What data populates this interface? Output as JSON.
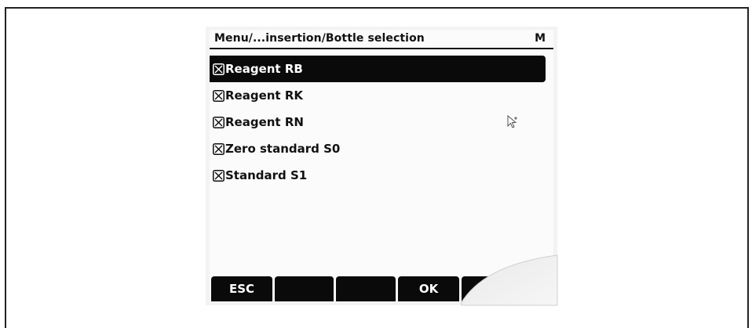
{
  "header": {
    "title": "Menu/...insertion/Bottle selection",
    "mode": "M"
  },
  "items": [
    {
      "label": "Reagent RB",
      "checked": true,
      "selected": true
    },
    {
      "label": "Reagent RK",
      "checked": true,
      "selected": false
    },
    {
      "label": "Reagent RN",
      "checked": true,
      "selected": false
    },
    {
      "label": "Zero standard S0",
      "checked": true,
      "selected": false
    },
    {
      "label": "Standard S1",
      "checked": true,
      "selected": false
    }
  ],
  "softkeys": [
    "ESC",
    "",
    "",
    "OK",
    ""
  ],
  "colors": {
    "screen_bg": "#fbfbfb",
    "highlight_bg": "#0a0a0a",
    "text": "#111111"
  }
}
